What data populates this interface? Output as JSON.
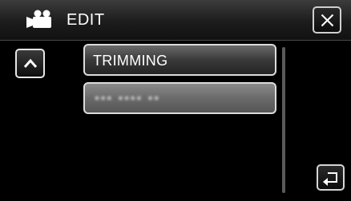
{
  "header": {
    "title": "EDIT",
    "mode_icon": "video-camera-icon",
    "close_icon": "close-icon"
  },
  "navigation": {
    "up_icon": "chevron-up-icon",
    "back_icon": "return-icon"
  },
  "menu": {
    "items": [
      {
        "label": "TRIMMING",
        "enabled": true
      },
      {
        "label": "▪▪▪ ▪▪▪▪ ▪▪",
        "enabled": false,
        "blurred": true
      }
    ]
  },
  "colors": {
    "background": "#000000",
    "button_border": "#dcdcdc",
    "text": "#ffffff"
  }
}
